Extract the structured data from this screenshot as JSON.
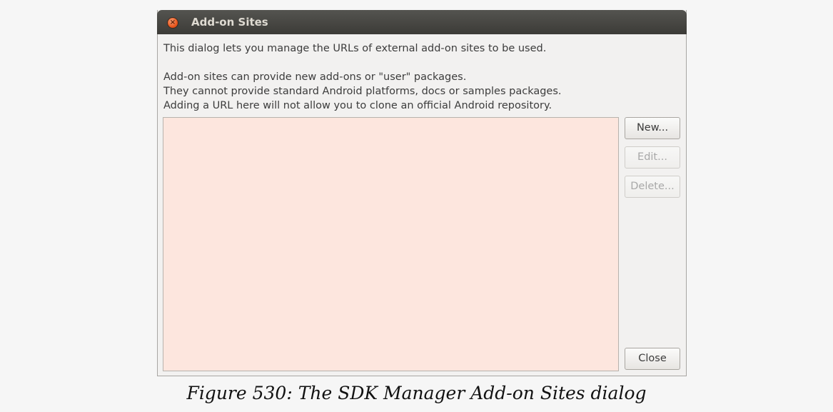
{
  "window": {
    "title": "Add-on Sites",
    "close_glyph": "×",
    "close_icon": "close-icon"
  },
  "description": {
    "line1": "This dialog lets you manage the URLs of external add-on sites to be used.",
    "line2": "Add-on sites can provide new add-ons or \"user\" packages.",
    "line3": "They cannot provide standard Android platforms, docs or samples packages.",
    "line4": "Adding a URL here will not allow you to clone an official Android repository."
  },
  "buttons": {
    "new_label": "New...",
    "edit_label": "Edit...",
    "delete_label": "Delete...",
    "close_label": "Close"
  },
  "sites": [],
  "colors": {
    "titlebar": "#3c3b37",
    "list_background": "#fde6de",
    "close_button": "#e9561d"
  },
  "caption": "Figure 530: The SDK Manager Add-on Sites dialog"
}
